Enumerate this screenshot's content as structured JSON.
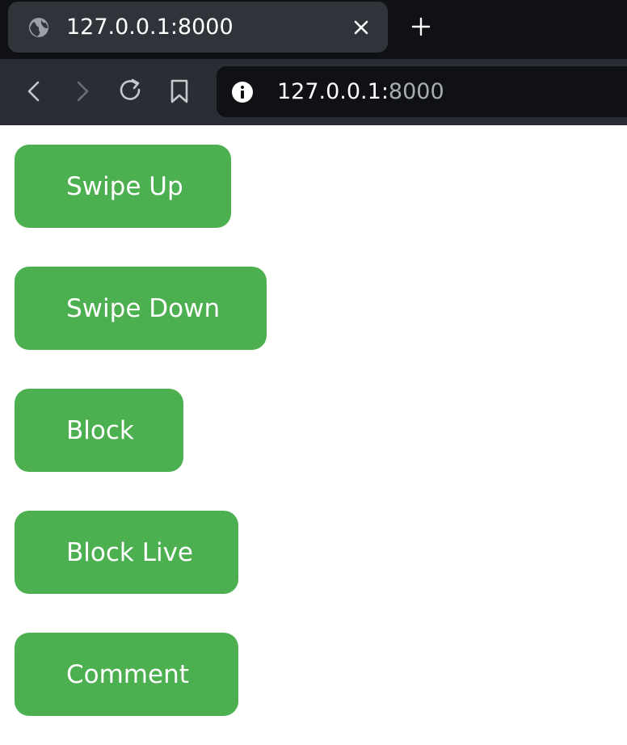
{
  "browser": {
    "tab": {
      "title": "127.0.0.1:8000",
      "favicon": "globe-icon"
    },
    "address_bar": {
      "host": "127.0.0.1:",
      "port": "8000"
    },
    "icons": {
      "close": "close-icon",
      "new_tab": "plus-icon",
      "back": "back-arrow-icon",
      "forward": "forward-arrow-icon",
      "reload": "reload-icon",
      "bookmark": "bookmark-icon",
      "site_info": "info-icon"
    },
    "colors": {
      "tabbar_bg": "#0f1115",
      "active_tab_bg": "#2f343b",
      "toolbar_bg": "#2a2e34"
    }
  },
  "page": {
    "buttons": [
      {
        "label": "Swipe Up"
      },
      {
        "label": "Swipe Down"
      },
      {
        "label": "Block"
      },
      {
        "label": "Block Live"
      },
      {
        "label": "Comment"
      }
    ],
    "colors": {
      "button_bg": "#4caf50",
      "button_text": "#ffffff"
    }
  }
}
